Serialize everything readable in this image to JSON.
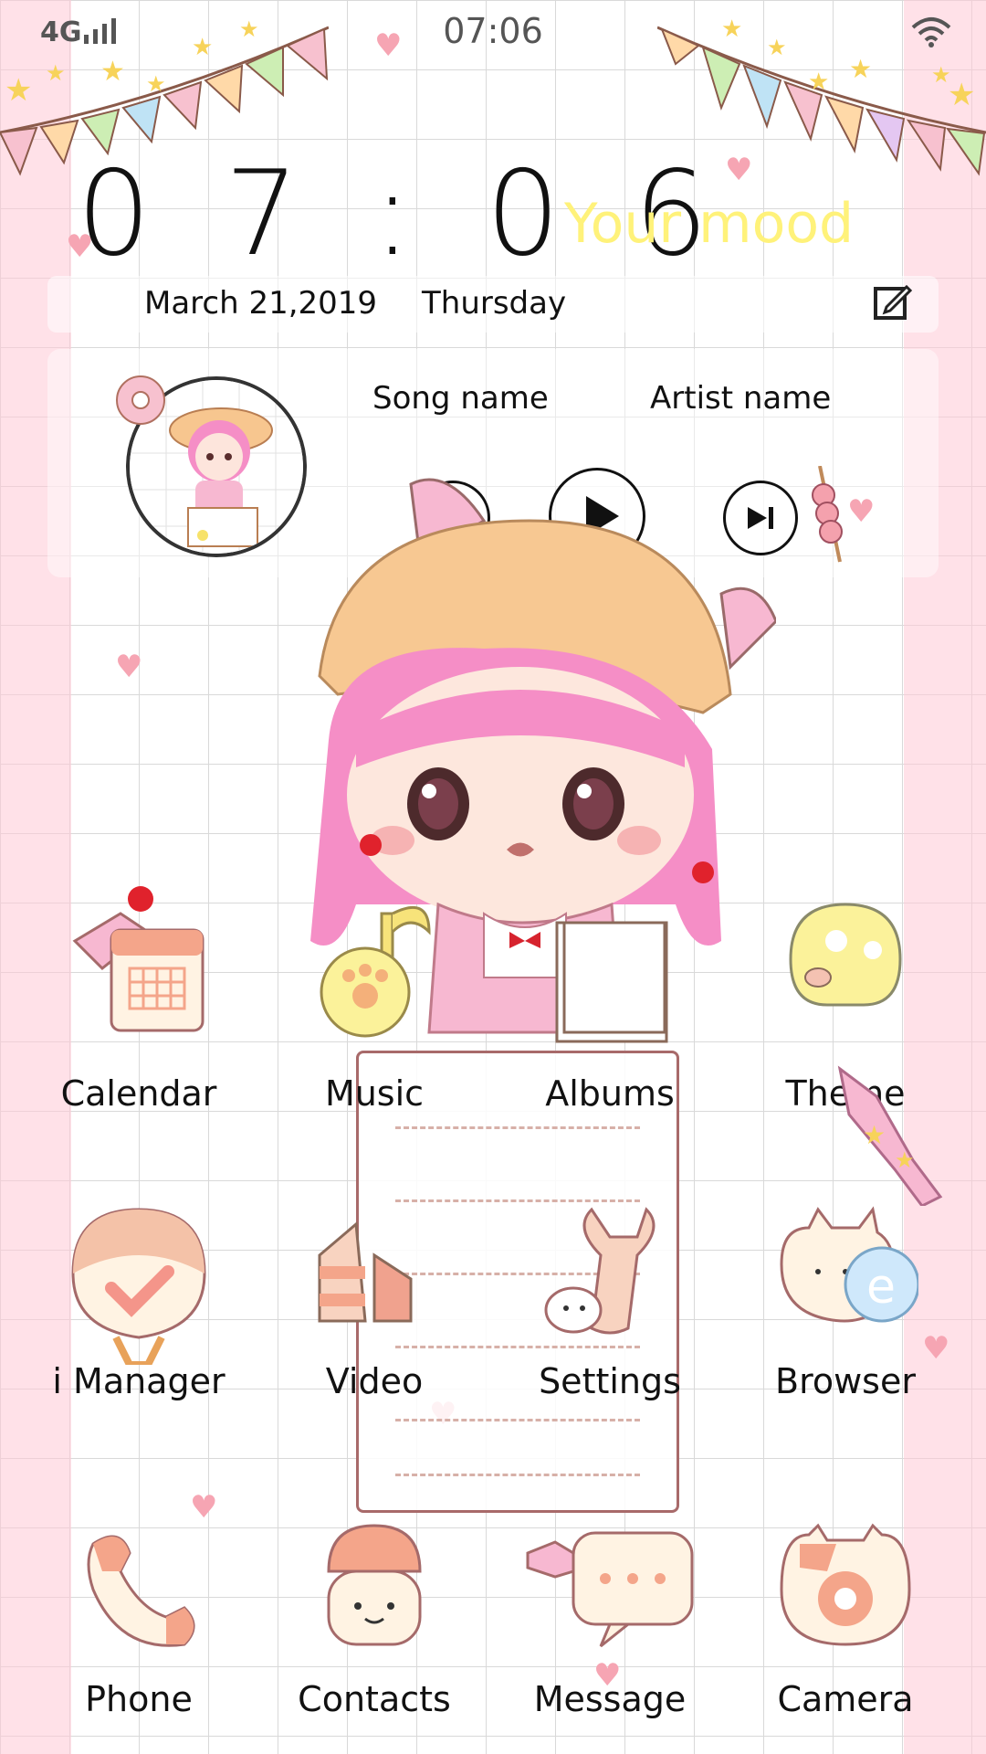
{
  "status_bar": {
    "network": "4G",
    "time": "07:06"
  },
  "widget": {
    "clock": "0 7 : 0 6",
    "mood": "Your mood",
    "date": "March 21,2019",
    "weekday": "Thursday"
  },
  "music": {
    "song_name": "Song name",
    "artist_name": "Artist name"
  },
  "apps": [
    {
      "label": "Calendar",
      "icon": "calendar-icon"
    },
    {
      "label": "Music",
      "icon": "music-note-icon"
    },
    {
      "label": "Albums",
      "icon": "photo-icon"
    },
    {
      "label": "Theme",
      "icon": "palette-icon"
    },
    {
      "label": "i Manager",
      "icon": "shield-check-icon"
    },
    {
      "label": "Video",
      "icon": "video-icon"
    },
    {
      "label": "Settings",
      "icon": "wrench-icon"
    },
    {
      "label": "Browser",
      "icon": "browser-icon"
    },
    {
      "label": "Phone",
      "icon": "phone-icon"
    },
    {
      "label": "Contacts",
      "icon": "contacts-icon"
    },
    {
      "label": "Message",
      "icon": "message-icon"
    },
    {
      "label": "Camera",
      "icon": "camera-icon"
    }
  ],
  "colors": {
    "accent_pink": "#f6a5b3",
    "mood_yellow": "#fff27a",
    "grid": "#d9d9d9"
  }
}
